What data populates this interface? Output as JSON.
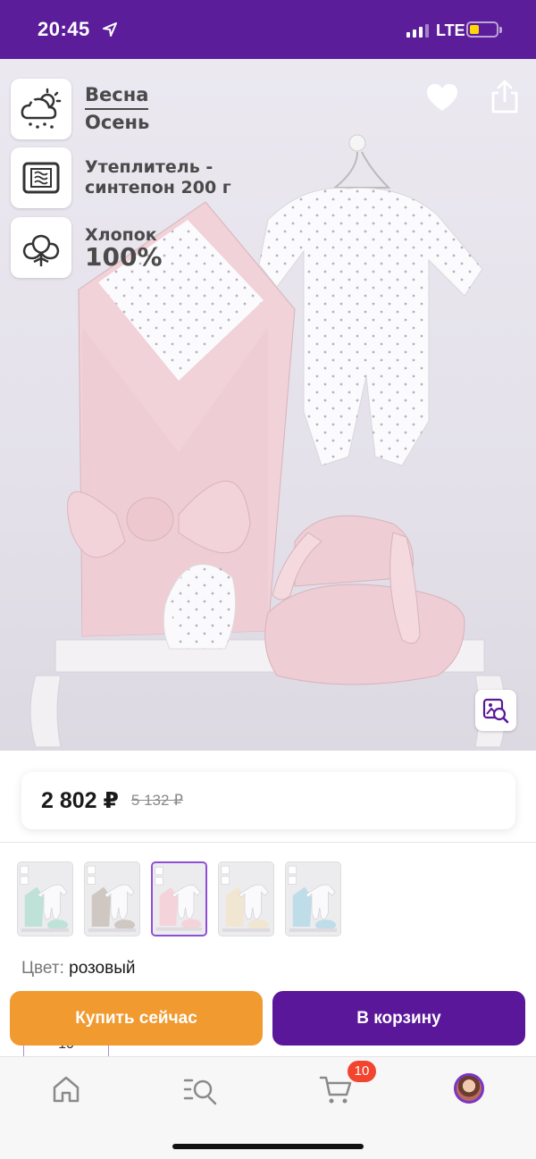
{
  "status_bar": {
    "time": "20:45",
    "network": "LTE",
    "icons": [
      "location-arrow-icon",
      "signal-icon",
      "battery-icon"
    ],
    "battery_level": 0.35
  },
  "product_photo": {
    "features": [
      {
        "icon": "weather-cloud-sun-icon",
        "line1": "Весна",
        "line2": "Осень"
      },
      {
        "icon": "padding-layers-icon",
        "line1": "Утеплитель -",
        "line2": "синтепон 200 г"
      },
      {
        "icon": "cotton-flower-icon",
        "line1": "Хлопок",
        "line2": "100%"
      }
    ],
    "actions": [
      "back-arrow-icon",
      "heart-icon",
      "share-icon",
      "image-search-icon"
    ]
  },
  "price": {
    "current": "2 802 ₽",
    "old": "5 132 ₽"
  },
  "thumbnails": {
    "colors": [
      "#bfe2d8",
      "#cfc7c2",
      "#f4d4da",
      "#f1e6d2",
      "#bfdde9"
    ],
    "selected_index": 2
  },
  "color": {
    "label": "Цвет:",
    "value": "розовый"
  },
  "buttons": {
    "buy_now": "Купить сейчас",
    "add_to_cart": "В корзину"
  },
  "quantity_peek": "10",
  "tab_bar": {
    "items": [
      "home-icon",
      "catalog-search-icon",
      "cart-icon",
      "profile-avatar"
    ],
    "cart_badge": "10"
  },
  "colors": {
    "brand_purple": "#5a1799",
    "buy_orange": "#f19a30",
    "badge_red": "#f2442f"
  }
}
